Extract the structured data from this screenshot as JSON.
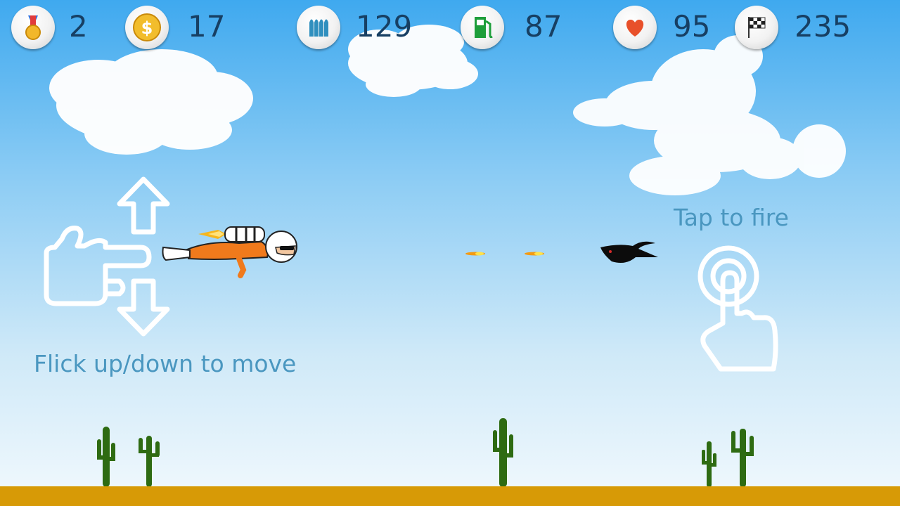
{
  "hud": {
    "medals": {
      "icon": "medal-icon",
      "value": "2"
    },
    "coins": {
      "icon": "dollar-coin-icon",
      "value": "17"
    },
    "ammo": {
      "icon": "bullets-icon",
      "value": "129"
    },
    "fuel": {
      "icon": "fuel-pump-icon",
      "value": "87"
    },
    "health": {
      "icon": "heart-icon",
      "value": "95"
    },
    "distance": {
      "icon": "checkered-flag-icon",
      "value": "235"
    }
  },
  "hints": {
    "move": "Flick up/down to move",
    "fire": "Tap to fire"
  },
  "colors": {
    "sky_top": "#3fa9ef",
    "sky_bottom": "#f2f9fd",
    "ground": "#d79a06",
    "hud_text": "#173f63",
    "hint_text": "#4a97c0",
    "cactus": "#2e6b12",
    "player_suit": "#f07a1c"
  }
}
